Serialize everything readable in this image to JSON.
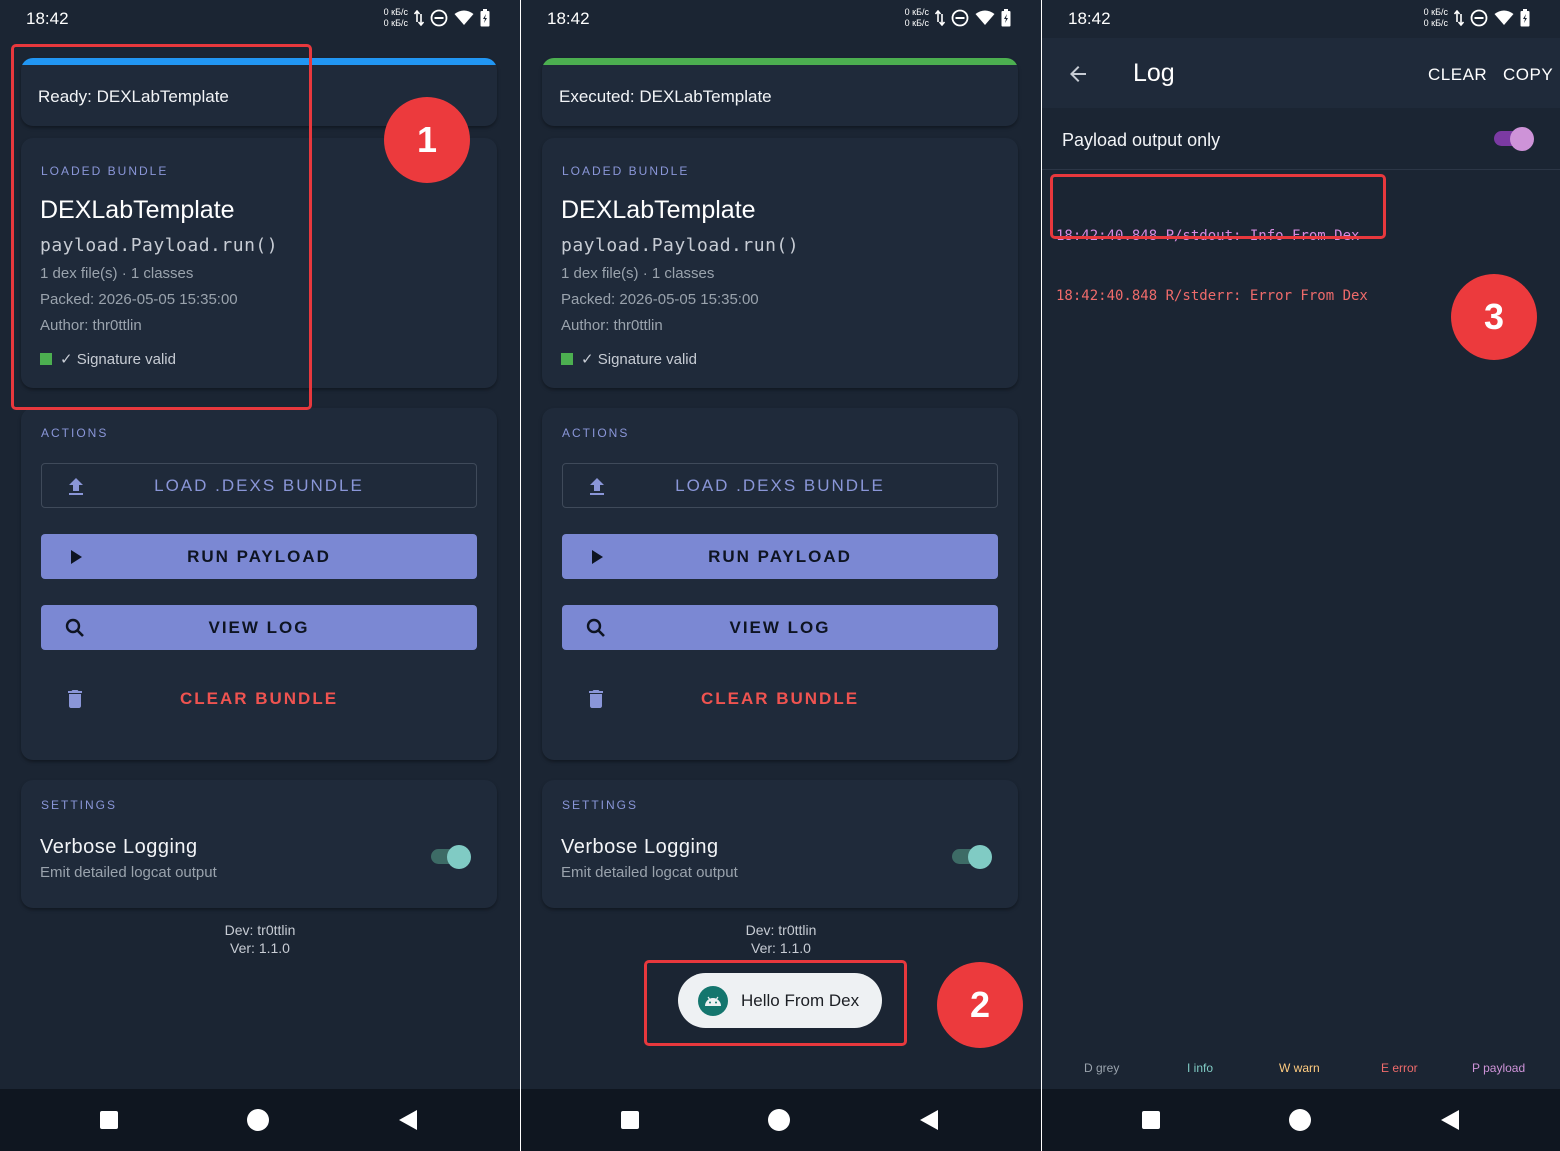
{
  "status_bar": {
    "time": "18:42",
    "net_up": "0 кБ/с",
    "net_down": "0 кБ/с"
  },
  "screen1": {
    "status_text": "Ready: DEXLabTemplate",
    "status_color": "#2196f3",
    "marker": "1"
  },
  "screen2": {
    "status_text": "Executed: DEXLabTemplate",
    "status_color": "#4caf50",
    "marker": "2",
    "toast": "Hello From Dex"
  },
  "bundle": {
    "section": "LOADED BUNDLE",
    "name": "DEXLabTemplate",
    "entry": "payload.Payload.run()",
    "files": "1 dex file(s)  ·  1 classes",
    "packed": "Packed: 2026-05-05  15:35:00",
    "author": "Author: thr0ttlin",
    "signature": "✓ Signature valid"
  },
  "actions": {
    "section": "ACTIONS",
    "load": "LOAD .DEXS BUNDLE",
    "run": "RUN PAYLOAD",
    "view_log": "VIEW LOG",
    "clear": "CLEAR BUNDLE"
  },
  "settings": {
    "section": "SETTINGS",
    "verbose_title": "Verbose Logging",
    "verbose_sub": "Emit detailed logcat output",
    "verbose_on": true
  },
  "footer": {
    "dev": "Dev: tr0ttlin",
    "ver": "Ver: 1.1.0"
  },
  "log_screen": {
    "title": "Log",
    "clear": "CLEAR",
    "copy": "COPY",
    "filter_label": "Payload output only",
    "filter_on": true,
    "marker": "3",
    "lines": [
      "18:42:40.848 P/stdout: Info From Dex",
      "18:42:40.848 R/stderr: Error From Dex"
    ],
    "legend": [
      "D grey",
      "I info",
      "W warn",
      "E error",
      "P payload"
    ],
    "legend_colors": [
      "#9aa3ad",
      "#80cbc4",
      "#ffcc80",
      "#ef6b6b",
      "#ce93d8"
    ]
  },
  "colors": {
    "background": "#1b2533",
    "card": "#1f2a3a",
    "accent": "#7b88d3",
    "danger": "#ef5350",
    "annotation": "#e8383d",
    "toggle_teal": "#80cbc4",
    "toggle_purple": "#ce93d8"
  }
}
